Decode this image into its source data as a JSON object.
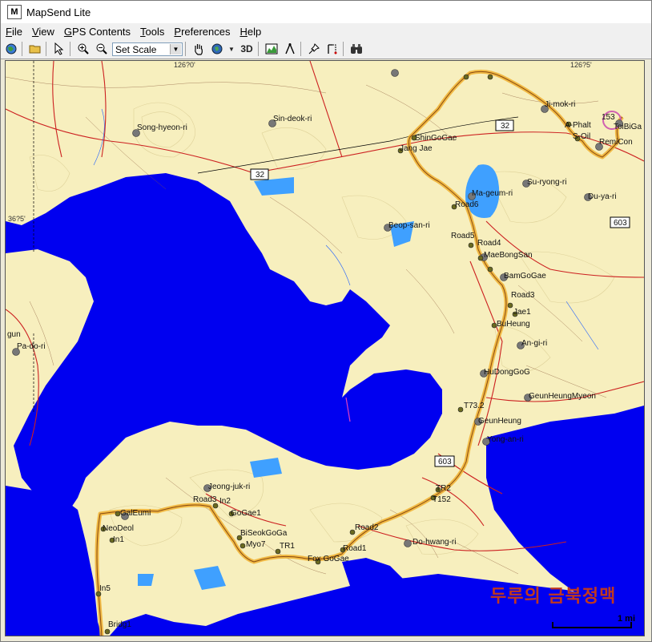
{
  "window": {
    "title": "MapSend Lite",
    "app_icon_letter": "M"
  },
  "menu": [
    "File",
    "View",
    "GPS Contents",
    "Tools",
    "Preferences",
    "Help"
  ],
  "toolbar": {
    "scale_value": "Set Scale",
    "button_3d": "3D"
  },
  "map": {
    "coords": {
      "top_left": "126?0'",
      "top_right": "126?5'",
      "left": "36?5'"
    },
    "road_shields": [
      "32",
      "32",
      "603",
      "603"
    ],
    "places": [
      "Sin-deok-ri",
      "Song-hyeon-ri",
      "ShinGoGae",
      "Jang Jae",
      "Ji-mok-ri",
      "153",
      "ToiBiGa",
      "A-Phalt",
      "S-Oil",
      "RemiCon",
      "Ma-geum-ri",
      "Su-ryong-ri",
      "Du-ya-ri",
      "Road6",
      "Beop-san-ri",
      "Road5",
      "Road4",
      "MaeBongSan",
      "BamGoGae",
      "Road3",
      "Jae1",
      "BuHeung",
      "An-gi-ri",
      "HuDongGoG",
      "GeunHeungMyeon",
      "T73.2",
      "GeunHeung",
      "Yong-an-ri",
      "Pa-do-ri",
      "gun",
      "Jeong-juk-ri",
      "Road3",
      "In2",
      "GoGae1",
      "GalEumi",
      "NeoDeol",
      "In1",
      "BiSeokGoGa",
      "Myo7",
      "TR1",
      "Fox GoGae",
      "Road1",
      "Road2",
      "TR2",
      "T152",
      "Do-hwang-ri",
      "In5",
      "Bridg1"
    ],
    "watermark": "두루의 금북정맥",
    "scale_label": "1 mi",
    "colors": {
      "land": "#f7efbe",
      "water": "#0000f0",
      "route": "#f0b030",
      "road": "#cc2020"
    }
  }
}
